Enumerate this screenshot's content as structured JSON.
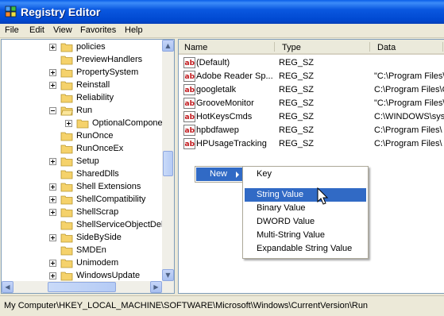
{
  "window": {
    "title": "Registry Editor"
  },
  "menu": [
    "File",
    "Edit",
    "View",
    "Favorites",
    "Help"
  ],
  "tree": [
    {
      "label": "policies",
      "expander": "plus",
      "indent": 0
    },
    {
      "label": "PreviewHandlers",
      "expander": "none",
      "indent": 0
    },
    {
      "label": "PropertySystem",
      "expander": "plus",
      "indent": 0
    },
    {
      "label": "Reinstall",
      "expander": "plus",
      "indent": 0
    },
    {
      "label": "Reliability",
      "expander": "none",
      "indent": 0
    },
    {
      "label": "Run",
      "expander": "minus",
      "indent": 0,
      "open": true
    },
    {
      "label": "OptionalCompone",
      "expander": "plus",
      "indent": 1
    },
    {
      "label": "RunOnce",
      "expander": "none",
      "indent": 0
    },
    {
      "label": "RunOnceEx",
      "expander": "none",
      "indent": 0
    },
    {
      "label": "Setup",
      "expander": "plus",
      "indent": 0
    },
    {
      "label": "SharedDlls",
      "expander": "none",
      "indent": 0
    },
    {
      "label": "Shell Extensions",
      "expander": "plus",
      "indent": 0
    },
    {
      "label": "ShellCompatibility",
      "expander": "plus",
      "indent": 0
    },
    {
      "label": "ShellScrap",
      "expander": "plus",
      "indent": 0
    },
    {
      "label": "ShellServiceObjectDel",
      "expander": "none",
      "indent": 0
    },
    {
      "label": "SideBySide",
      "expander": "plus",
      "indent": 0
    },
    {
      "label": "SMDEn",
      "expander": "none",
      "indent": 0
    },
    {
      "label": "Unimodem",
      "expander": "plus",
      "indent": 0
    },
    {
      "label": "WindowsUpdate",
      "expander": "plus",
      "indent": 0
    }
  ],
  "list": {
    "columns": [
      "Name",
      "Type",
      "Data"
    ],
    "rows": [
      {
        "name": "(Default)",
        "type": "REG_SZ",
        "data": ""
      },
      {
        "name": "Adobe Reader Sp...",
        "type": "REG_SZ",
        "data": "\"C:\\Program Files\\"
      },
      {
        "name": "googletalk",
        "type": "REG_SZ",
        "data": "C:\\Program Files\\G"
      },
      {
        "name": "GrooveMonitor",
        "type": "REG_SZ",
        "data": "\"C:\\Program Files\\"
      },
      {
        "name": "HotKeysCmds",
        "type": "REG_SZ",
        "data": "C:\\WINDOWS\\sys"
      },
      {
        "name": "hpbdfawep",
        "type": "REG_SZ",
        "data": "C:\\Program Files\\"
      },
      {
        "name": "HPUsageTracking",
        "type": "REG_SZ",
        "data": "C:\\Program Files\\"
      }
    ]
  },
  "context_menu": {
    "new_label": "New",
    "submenu": [
      "Key",
      "String Value",
      "Binary Value",
      "DWORD Value",
      "Multi-String Value",
      "Expandable String Value"
    ],
    "selected_index": 1
  },
  "status": "My Computer\\HKEY_LOCAL_MACHINE\\SOFTWARE\\Microsoft\\Windows\\CurrentVersion\\Run",
  "colors": {
    "titlebar": "#0054e3",
    "selection": "#316ac5",
    "folder": "#f5d26b"
  }
}
